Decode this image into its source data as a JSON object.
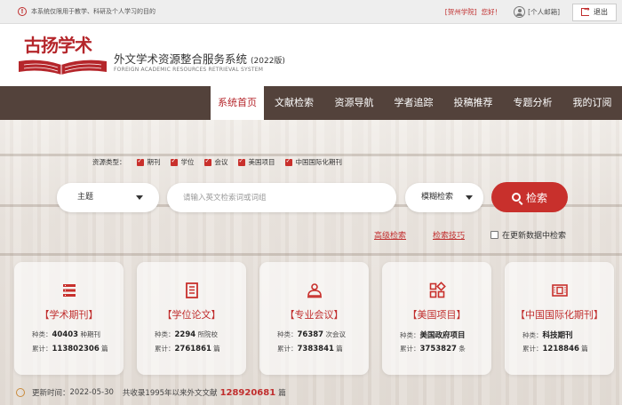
{
  "topbar": {
    "notice": "本系统仅限用于教学、科研及个人学习的目的",
    "school": "[贺州学院]",
    "greeting": "您好！",
    "mailbox": "[个人邮箱]",
    "logout": "退出"
  },
  "header": {
    "logo_text": "古扬学术",
    "title": "外文学术资源整合服务系统",
    "title_year": "(2022版)",
    "subtitle": "FOREIGN ACADEMIC RESOURCES RETRIEVAL SYSTEM"
  },
  "nav": {
    "items": [
      {
        "label": "系统首页",
        "active": true
      },
      {
        "label": "文献检索",
        "active": false
      },
      {
        "label": "资源导航",
        "active": false
      },
      {
        "label": "学者追踪",
        "active": false
      },
      {
        "label": "投稿推荐",
        "active": false
      },
      {
        "label": "专题分析",
        "active": false
      },
      {
        "label": "我的订阅",
        "active": false
      }
    ]
  },
  "search": {
    "types_label": "资源类型：",
    "types": [
      "期刊",
      "学位",
      "会议",
      "美国项目",
      "中国国际化期刊"
    ],
    "field": "主题",
    "placeholder": "请输入英文检索词或词组",
    "mode": "模糊检索",
    "button": "检索",
    "advanced": "高级检索",
    "tips": "检索技巧",
    "update_check": "在更新数据中检索"
  },
  "cards": [
    {
      "icon": "journal-icon",
      "title": "【学术期刊】",
      "k1": "种类：",
      "v1": "40403",
      "u1": "种期刊",
      "k2": "累计：",
      "v2": "113802306",
      "u2": "篇"
    },
    {
      "icon": "thesis-icon",
      "title": "【学位论文】",
      "k1": "种类：",
      "v1": "2294",
      "u1": "所院校",
      "k2": "累计：",
      "v2": "2761861",
      "u2": "篇"
    },
    {
      "icon": "conference-icon",
      "title": "【专业会议】",
      "k1": "种类：",
      "v1": "76387",
      "u1": "次会议",
      "k2": "累计：",
      "v2": "7383841",
      "u2": "篇"
    },
    {
      "icon": "project-icon",
      "title": "【美国项目】",
      "k1": "种类：",
      "v1": "美国政府项目",
      "u1": "",
      "k2": "累计：",
      "v2": "3753827",
      "u2": "条"
    },
    {
      "icon": "intl-journal-icon",
      "title": "【中国国际化期刊】",
      "k1": "种类：",
      "v1": "科技期刊",
      "u1": "",
      "k2": "累计：",
      "v2": "1218846",
      "u2": "篇"
    }
  ],
  "footer": {
    "update_label": "更新时间：",
    "update_date": "2022-05-30",
    "total_prefix": "共收录1995年以来外文文献",
    "total_value": "128920681",
    "total_unit": "篇"
  },
  "colors": {
    "accent": "#c8302c",
    "nav_bg": "#53423b"
  }
}
